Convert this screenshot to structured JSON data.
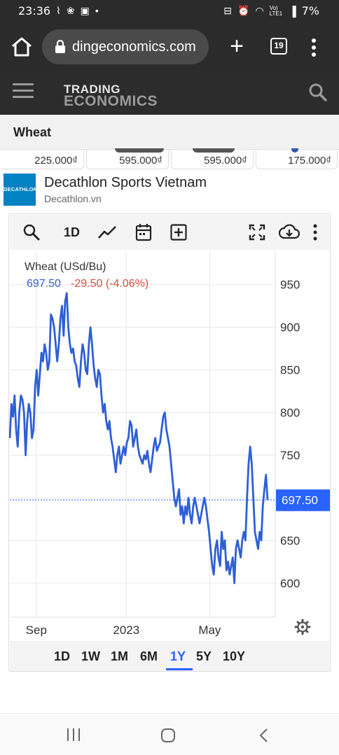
{
  "status_bar": {
    "time": "23:36",
    "left_icons": [
      "signal-wave-icon",
      "pinwheel-icon",
      "image-icon",
      "dot-icon"
    ],
    "right_icons": [
      "bed-icon",
      "alarm-icon",
      "wifi-icon",
      "volte-icon",
      "signal-icon"
    ],
    "network_label": "Vo) LTE1",
    "battery": "7%"
  },
  "browser": {
    "url": "dingeconomics.com",
    "tab_count": "19"
  },
  "site_header": {
    "logo_line1": "TRADING",
    "logo_line2": "ECONOMICS"
  },
  "page": {
    "title": "Wheat"
  },
  "ad_prices": [
    "225.000₫",
    "595.000₫",
    "595.000₫",
    "175.000₫"
  ],
  "ad": {
    "logo_text": "DECATHLON",
    "title": "Decathlon Sports Vietnam",
    "domain": "Decathlon.vn",
    "brand_color": "#0082c3"
  },
  "chart_toolbar": {
    "interval": "1D"
  },
  "chart_data": {
    "type": "line",
    "title": "Wheat (USd/Bu)",
    "last_value": "697.50",
    "change": "-29.50 (-4.06%)",
    "price_tag": "697.50",
    "y_ticks": [
      "950",
      "900",
      "850",
      "800",
      "750",
      "700",
      "650",
      "600"
    ],
    "x_ticks": [
      "Sep",
      "2023",
      "May"
    ],
    "ylim": [
      560,
      990
    ],
    "line_color": "#2e5fd8",
    "change_color": "#e0483e",
    "grid": true,
    "series": [
      {
        "values": [
          770,
          810,
          795,
          820,
          780,
          760,
          800,
          820,
          815,
          800,
          750,
          790,
          810,
          800,
          770,
          780,
          830,
          850,
          820,
          845,
          870,
          860,
          880,
          870,
          850,
          860,
          915,
          910,
          900,
          880,
          860,
          880,
          910,
          925,
          890,
          930,
          940,
          900,
          880,
          870,
          875,
          860,
          855,
          840,
          830,
          860,
          880,
          870,
          850,
          845,
          880,
          900,
          880,
          855,
          840,
          830,
          850,
          845,
          820,
          800,
          810,
          790,
          780,
          790,
          770,
          760,
          745,
          730,
          750,
          760,
          740,
          750,
          760,
          750,
          765,
          770,
          790,
          785,
          760,
          770,
          780,
          760,
          750,
          745,
          740,
          750,
          745,
          755,
          740,
          730,
          745,
          760,
          770,
          755,
          760,
          765,
          780,
          795,
          800,
          780,
          770,
          760,
          740,
          720,
          700,
          690,
          700,
          710,
          680,
          690,
          670,
          690,
          680,
          700,
          680,
          670,
          690,
          700,
          690,
          680,
          670,
          680,
          690,
          700,
          690,
          675,
          660,
          640,
          620,
          610,
          640,
          650,
          630,
          620,
          660,
          640,
          650,
          615,
          625,
          610,
          620,
          630,
          600,
          640,
          650,
          640,
          630,
          650,
          660,
          650,
          700,
          740,
          760,
          740,
          700,
          660,
          650,
          640,
          660,
          650,
          690,
          710,
          727,
          697.5
        ]
      }
    ]
  },
  "periods": [
    "1D",
    "1W",
    "1M",
    "6M",
    "1Y",
    "5Y",
    "10Y"
  ],
  "active_period": "1Y"
}
